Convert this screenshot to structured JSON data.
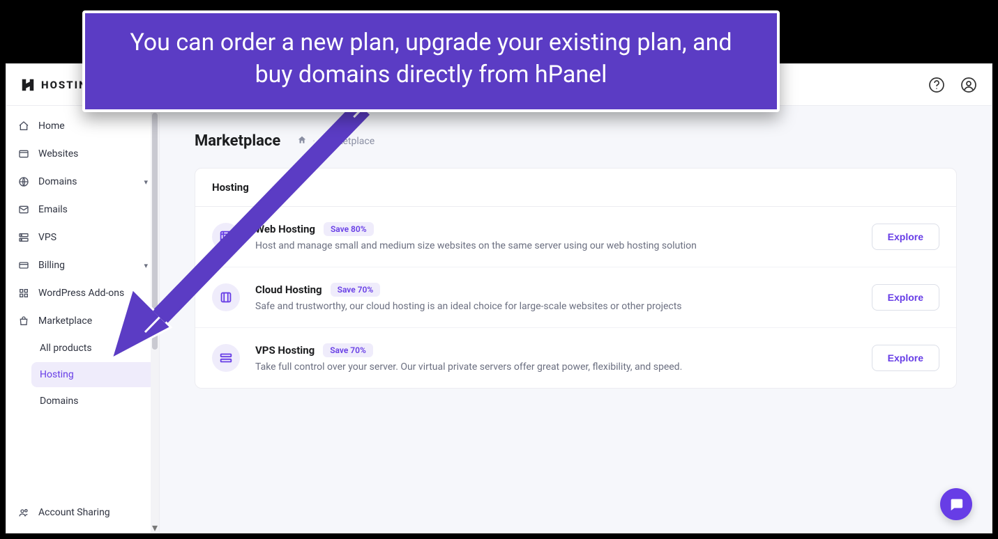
{
  "brand": {
    "name": "HOSTINGER"
  },
  "callout": {
    "text": "You can order a new plan, upgrade your existing plan, and buy domains directly from hPanel"
  },
  "sidebar": {
    "items": [
      {
        "label": "Home"
      },
      {
        "label": "Websites"
      },
      {
        "label": "Domains"
      },
      {
        "label": "Emails"
      },
      {
        "label": "VPS"
      },
      {
        "label": "Billing"
      },
      {
        "label": "WordPress Add-ons"
      },
      {
        "label": "Marketplace"
      }
    ],
    "marketplace_sub": [
      {
        "label": "All products"
      },
      {
        "label": "Hosting"
      },
      {
        "label": "Domains"
      }
    ],
    "footer": {
      "label": "Account Sharing"
    }
  },
  "page": {
    "title": "Marketplace",
    "breadcrumb": {
      "current": "Marketplace"
    }
  },
  "card": {
    "heading": "Hosting",
    "explore_label": "Explore",
    "products": [
      {
        "title": "Web Hosting",
        "badge": "Save 80%",
        "desc": "Host and manage small and medium size websites on the same server using our web hosting solution"
      },
      {
        "title": "Cloud Hosting",
        "badge": "Save 70%",
        "desc": "Safe and trustworthy, our cloud hosting is an ideal choice for large-scale websites or other projects"
      },
      {
        "title": "VPS Hosting",
        "badge": "Save 70%",
        "desc": "Take full control over your server. Our virtual private servers offer great power, flexibility, and speed."
      }
    ]
  }
}
